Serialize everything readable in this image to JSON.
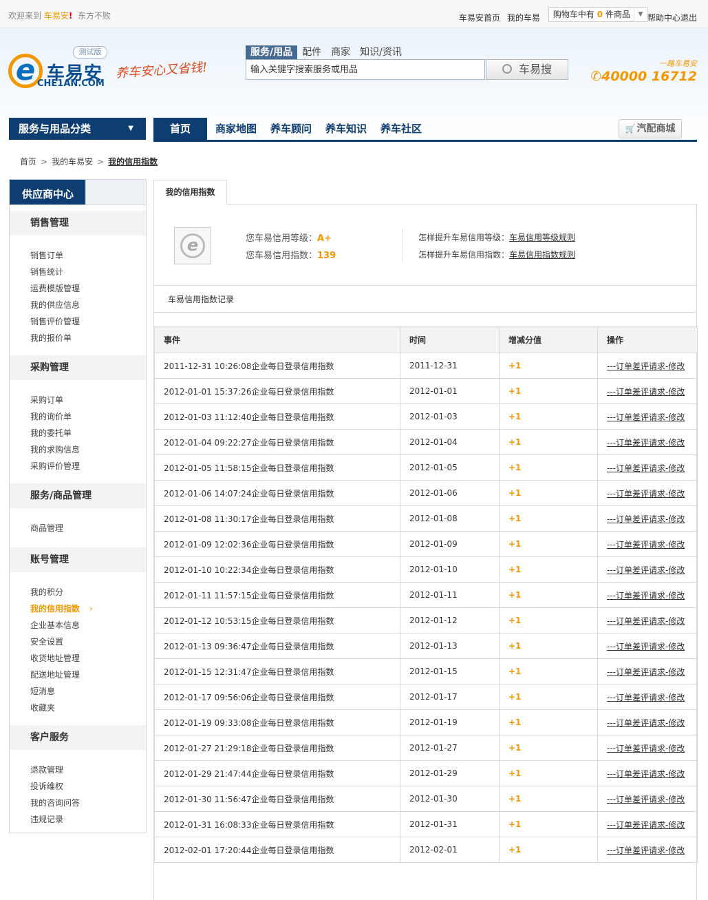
{
  "topbar": {
    "welcome": "欢迎来到",
    "brand": "车易安",
    "bang": "!",
    "user": "东方不败",
    "home": "车易安首页",
    "mine": "我的车易",
    "cart_prefix": "购物车中有",
    "cart_count": "0",
    "cart_suffix": "件商品",
    "help": "帮助中心",
    "logout": "退出"
  },
  "header": {
    "logo_badge": "测试版",
    "logo_letter": "e",
    "logo_cn": "车易安",
    "logo_en": "CHE1AN.COM",
    "slogan": "养车安心又省钱!",
    "search_tabs": [
      "服务/用品",
      "配件",
      "商家",
      "知识/资讯"
    ],
    "search_value": "输入关键字搜索服务或用品",
    "search_button": "车易搜",
    "hotline_sub": "一路车易安",
    "hotline": "40000 16712"
  },
  "nav": {
    "category": "服务与用品分类",
    "items": [
      "首页",
      "商家地图",
      "养车顾问",
      "养车知识",
      "养车社区"
    ],
    "mall": "汽配商城"
  },
  "breadcrumb": [
    "首页",
    "我的车易安",
    "我的信用指数"
  ],
  "sidebar": {
    "title": "供应商中心",
    "sections": [
      {
        "title": "销售管理",
        "items": [
          "销售订单",
          "销售统计",
          "运费模版管理",
          "我的供应信息",
          "销售评价管理",
          "我的报价单"
        ]
      },
      {
        "title": "采购管理",
        "items": [
          "采购订单",
          "我的询价单",
          "我的委托单",
          "我的求购信息",
          "采购评价管理"
        ]
      },
      {
        "title": "服务/商品管理",
        "items": [
          "商品管理"
        ]
      },
      {
        "title": "账号管理",
        "items": [
          "我的积分",
          "我的信用指数",
          "企业基本信息",
          "安全设置",
          "收货地址管理",
          "配送地址管理",
          "短消息",
          "收藏夹"
        ]
      },
      {
        "title": "客户服务",
        "items": [
          "退款管理",
          "投诉维权",
          "我的咨询问答",
          "违规记录"
        ]
      }
    ],
    "active_chevron": "›"
  },
  "main": {
    "tab": "我的信用指数",
    "level_label": "您车易信用等级：",
    "level_value": "A+",
    "index_label": "您车易信用指数：",
    "index_value": "139",
    "how_level": "怎样提升车易信用等级：",
    "how_level_link": "车易信用等级规则",
    "how_index": "怎样提升车易信用指数：",
    "how_index_link": "车易信用指数规则",
    "records_title": "车易信用指数记录",
    "columns": [
      "事件",
      "时间",
      "增减分值",
      "操作"
    ],
    "rows": [
      [
        "2011-12-31 10:26:08企业每日登录信用指数",
        "2011-12-31",
        "+1",
        "---订单差评请求-修改"
      ],
      [
        "2012-01-01 15:37:26企业每日登录信用指数",
        "2012-01-01",
        "+1",
        "---订单差评请求-修改"
      ],
      [
        "2012-01-03 11:12:40企业每日登录信用指数",
        "2012-01-03",
        "+1",
        "---订单差评请求-修改"
      ],
      [
        "2012-01-04 09:22:27企业每日登录信用指数",
        "2012-01-04",
        "+1",
        "---订单差评请求-修改"
      ],
      [
        "2012-01-05 11:58:15企业每日登录信用指数",
        "2012-01-05",
        "+1",
        "---订单差评请求-修改"
      ],
      [
        "2012-01-06 14:07:24企业每日登录信用指数",
        "2012-01-06",
        "+1",
        "---订单差评请求-修改"
      ],
      [
        "2012-01-08 11:30:17企业每日登录信用指数",
        "2012-01-08",
        "+1",
        "---订单差评请求-修改"
      ],
      [
        "2012-01-09 12:02:36企业每日登录信用指数",
        "2012-01-09",
        "+1",
        "---订单差评请求-修改"
      ],
      [
        "2012-01-10 10:22:34企业每日登录信用指数",
        "2012-01-10",
        "+1",
        "---订单差评请求-修改"
      ],
      [
        "2012-01-11 11:57:15企业每日登录信用指数",
        "2012-01-11",
        "+1",
        "---订单差评请求-修改"
      ],
      [
        "2012-01-12 10:53:15企业每日登录信用指数",
        "2012-01-12",
        "+1",
        "---订单差评请求-修改"
      ],
      [
        "2012-01-13 09:36:47企业每日登录信用指数",
        "2012-01-13",
        "+1",
        "---订单差评请求-修改"
      ],
      [
        "2012-01-15 12:31:47企业每日登录信用指数",
        "2012-01-15",
        "+1",
        "---订单差评请求-修改"
      ],
      [
        "2012-01-17 09:56:06企业每日登录信用指数",
        "2012-01-17",
        "+1",
        "---订单差评请求-修改"
      ],
      [
        "2012-01-19 09:33:08企业每日登录信用指数",
        "2012-01-19",
        "+1",
        "---订单差评请求-修改"
      ],
      [
        "2012-01-27 21:29:18企业每日登录信用指数",
        "2012-01-27",
        "+1",
        "---订单差评请求-修改"
      ],
      [
        "2012-01-29 21:47:44企业每日登录信用指数",
        "2012-01-29",
        "+1",
        "---订单差评请求-修改"
      ],
      [
        "2012-01-30 11:56:47企业每日登录信用指数",
        "2012-01-30",
        "+1",
        "---订单差评请求-修改"
      ],
      [
        "2012-01-31 16:08:33企业每日登录信用指数",
        "2012-01-31",
        "+1",
        "---订单差评请求-修改"
      ],
      [
        "2012-02-01 17:20:44企业每日登录信用指数",
        "2012-02-01",
        "+1",
        "---订单差评请求-修改"
      ]
    ]
  },
  "colors": {
    "brand_orange": "#f39800",
    "navy": "#0e3d72"
  },
  "icons": [
    "chevron-down-icon",
    "search-icon",
    "phone-icon",
    "cart-icon",
    "logo-e-icon",
    "avatar-icon"
  ]
}
